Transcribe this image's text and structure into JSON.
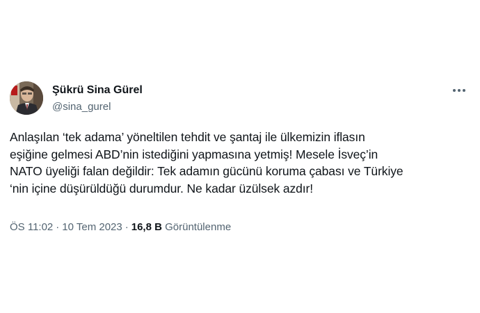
{
  "author": {
    "name": "Şükrü Sina Gürel",
    "handle": "@sina_gurel"
  },
  "tweet": {
    "lines": [
      "Anlaşılan ‘tek adama’ yöneltilen tehdit ve şantaj ile ülkemizin iflasın",
      "eşiğine gelmesi ABD’nin istediğini yapmasına yetmiş! Mesele İsveç’in",
      "NATO üyeliği falan değildir: Tek adamın gücünü koruma çabası ve Türkiye",
      "‘nin içine düşürüldüğü durumdur. Ne kadar üzülsek azdır!"
    ]
  },
  "meta": {
    "time": "ÖS 11:02",
    "separator": "·",
    "date": "10 Tem 2023",
    "views_count": "16,8 B",
    "views_label": "Görüntülenme"
  },
  "icons": {
    "more": "more-horizontal-icon"
  },
  "colors": {
    "text_primary": "#0f1419",
    "text_secondary": "#536471",
    "background": "#ffffff"
  }
}
